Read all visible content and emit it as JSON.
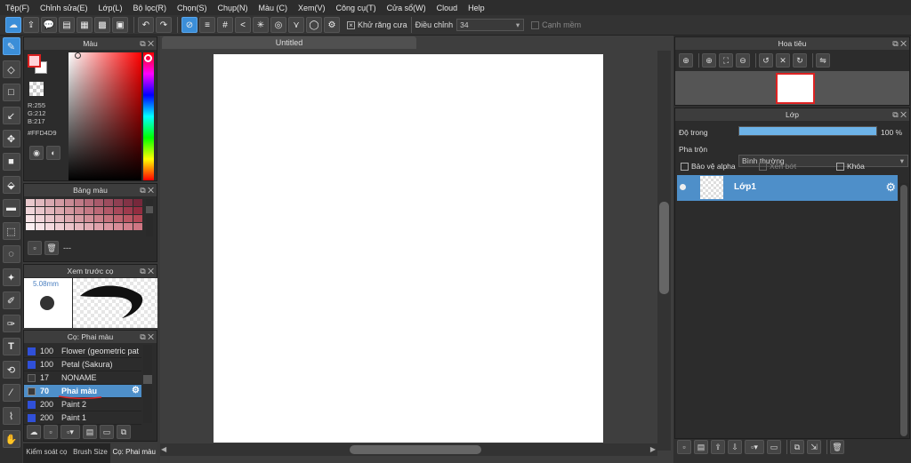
{
  "menu": [
    "Tệp(F)",
    "Chỉnh sửa(E)",
    "Lớp(L)",
    "Bộ lọc(R)",
    "Chọn(S)",
    "Chụp(N)",
    "Màu (C)",
    "Xem(V)",
    "Công cụ(T)",
    "Cửa sổ(W)",
    "Cloud",
    "Help"
  ],
  "toolbar": {
    "antialias_label": "Khử răng cưa",
    "adjust_label": "Điều chỉnh",
    "adjust_value": "34",
    "smooth_label": "Cạnh mềm"
  },
  "color_panel": {
    "title": "Màu",
    "r": "R:255",
    "g": "G:212",
    "b": "B:217",
    "hex": "#FFD4D9"
  },
  "palette_panel": {
    "title": "Bảng màu",
    "colors": [
      "#e8c8cc",
      "#e0b8be",
      "#d8a8b0",
      "#d29aa3",
      "#c88a95",
      "#bf7a87",
      "#b46a79",
      "#a85a6b",
      "#9c4c5e",
      "#8f3f52",
      "#823346",
      "#76283b",
      "#f0d6da",
      "#e8c6cb",
      "#e2b6bc",
      "#dba8ae",
      "#d498a0",
      "#cc8892",
      "#c47884",
      "#bb6876",
      "#b25868",
      "#a8485a",
      "#9e3a4d",
      "#932d40",
      "#f6e2e5",
      "#f0d4d8",
      "#eac6cb",
      "#e4b8be",
      "#deaab1",
      "#d89ca4",
      "#d28e97",
      "#cc808a",
      "#c6727d",
      "#c06470",
      "#ba5663",
      "#b44856",
      "#fbeff1",
      "#f7e4e7",
      "#f3d9dd",
      "#efced3",
      "#ebc3c9",
      "#e7b8bf",
      "#e3adb5",
      "#dfa2ab",
      "#db97a1",
      "#d78c97",
      "#d3818d",
      "#cf7683"
    ],
    "dash": "---"
  },
  "brush_preview_panel": {
    "title": "Xem trước cọ",
    "size": "5.08mm"
  },
  "brush_panel": {
    "title": "Cọ: Phai màu",
    "rows": [
      {
        "size": "100",
        "name": "Flower (geometric pat",
        "color": "#3050d8"
      },
      {
        "size": "100",
        "name": "Petal (Sakura)",
        "color": "#3050d8"
      },
      {
        "size": "17",
        "name": "NONAME",
        "color": "#3a3a3a"
      },
      {
        "size": "70",
        "name": "Phai màu",
        "color": "#3a3a3a"
      },
      {
        "size": "200",
        "name": "Paint 2",
        "color": "#3050d8"
      },
      {
        "size": "200",
        "name": "Paint 1",
        "color": "#3050d8"
      }
    ],
    "tabs": [
      "Kiểm soát cọ",
      "Brush Size",
      "Cọ: Phai màu"
    ]
  },
  "canvas": {
    "tab_title": "Untitled"
  },
  "navigator": {
    "title": "Hoa tiêu"
  },
  "layer_panel": {
    "title": "Lớp",
    "opacity_label": "Độ trong",
    "opacity_value": "100 %",
    "opacity_fraction": 1.0,
    "blend_label": "Pha trộn",
    "blend_value": "Bình thường",
    "protect_alpha": "Bảo vệ alpha",
    "clipping": "Xén bớt",
    "lock": "Khóa",
    "layers": [
      {
        "name": "Lớp1"
      }
    ]
  }
}
